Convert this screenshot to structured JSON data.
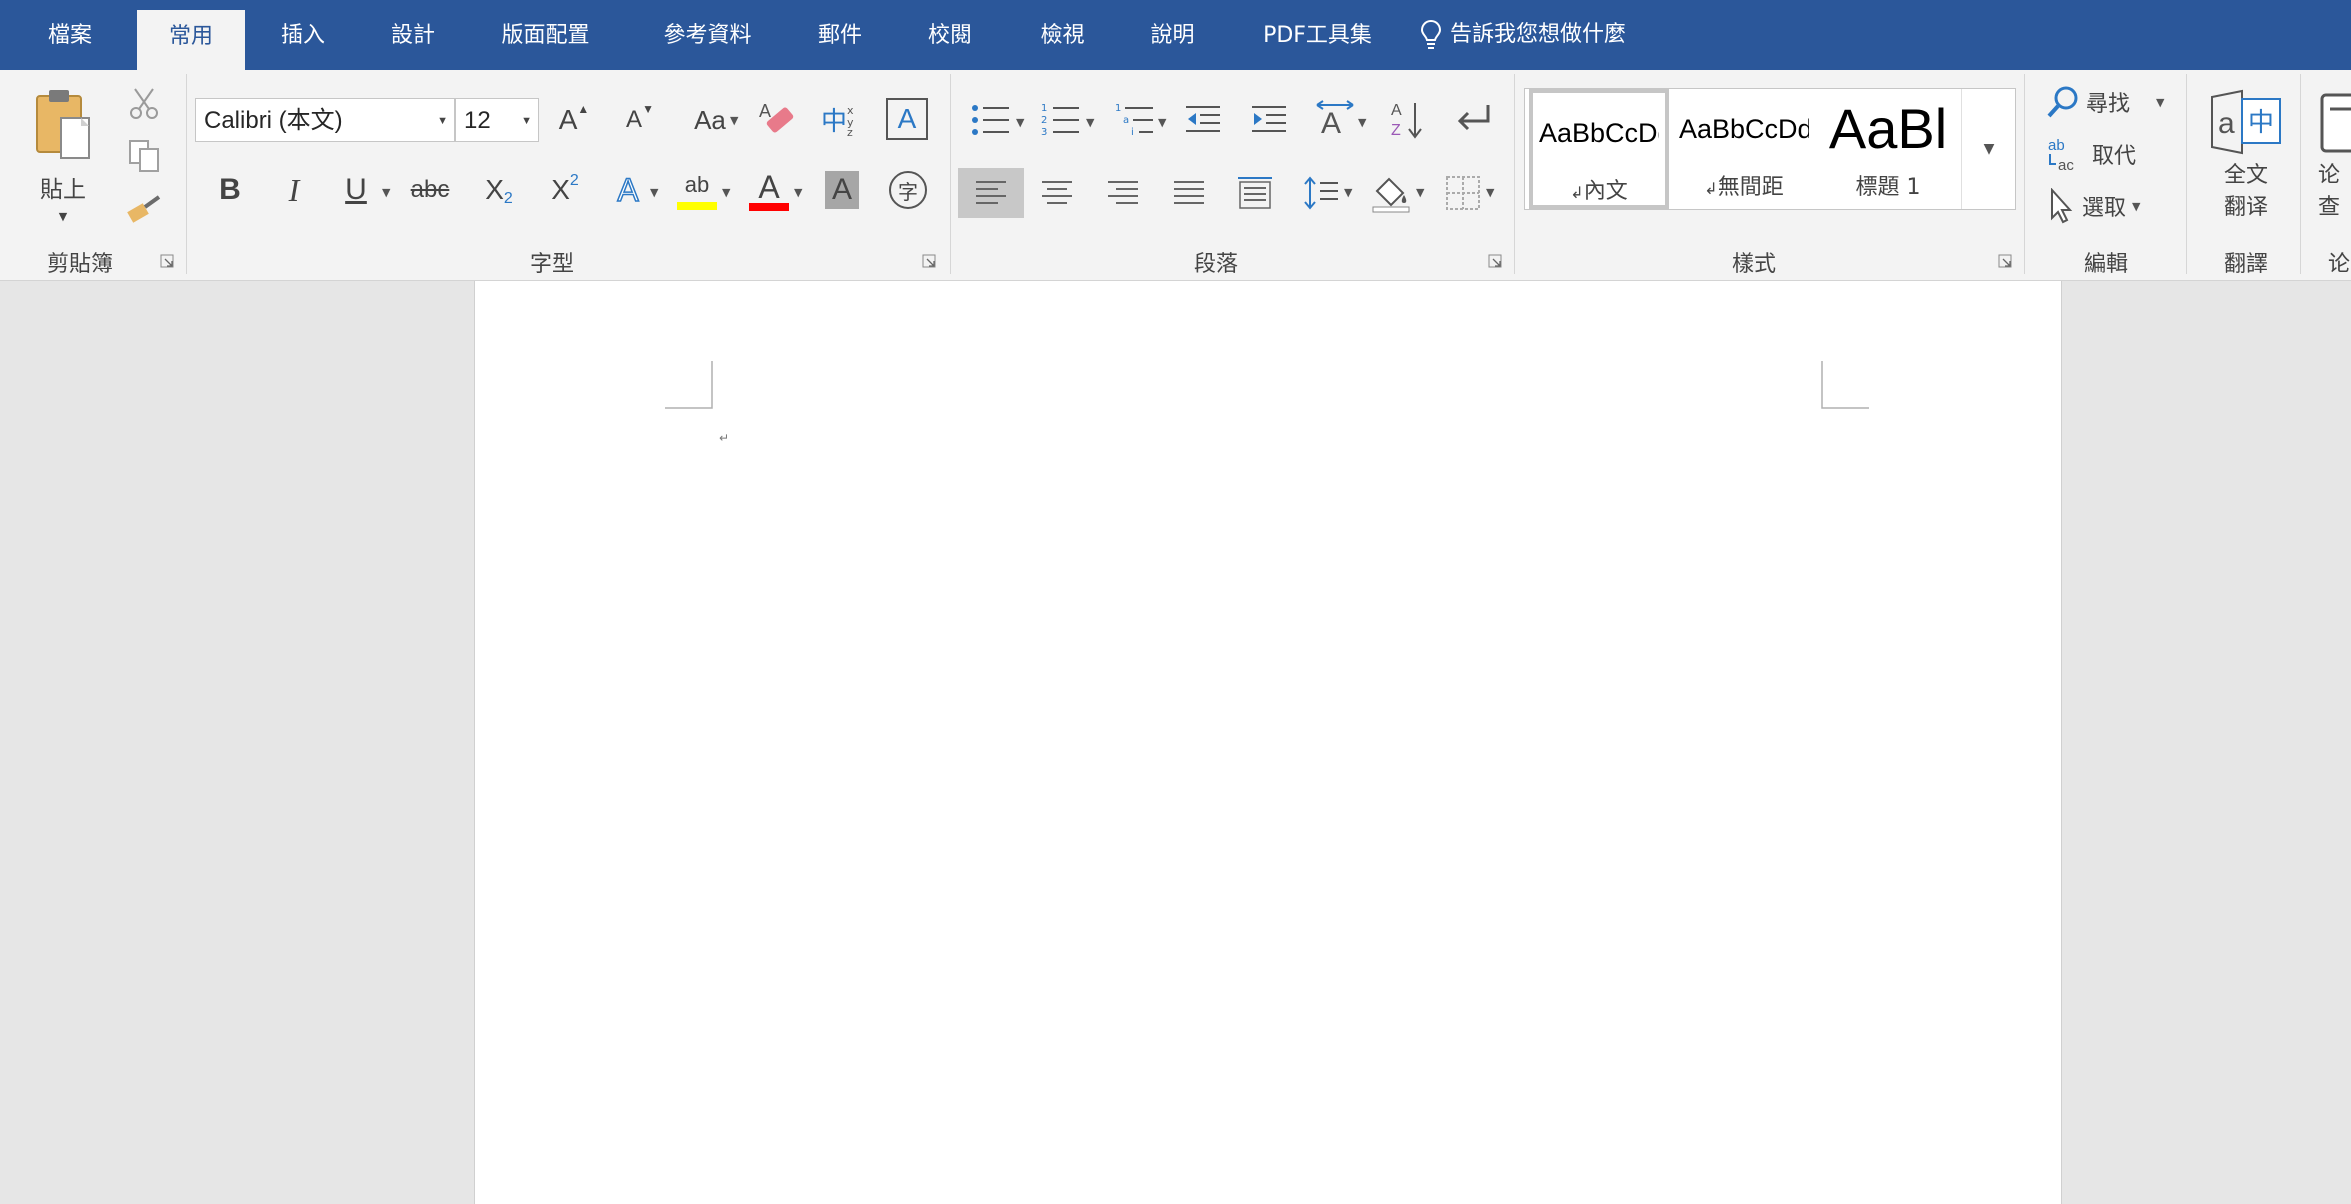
{
  "tabs": [
    "檔案",
    "常用",
    "插入",
    "設計",
    "版面配置",
    "參考資料",
    "郵件",
    "校閱",
    "檢視",
    "說明",
    "PDF工具集"
  ],
  "active_tab": "常用",
  "tell_me": "告訴我您想做什麼",
  "groups": {
    "clipboard": "剪貼簿",
    "font": "字型",
    "paragraph": "段落",
    "styles": "樣式",
    "editing": "編輯",
    "translate": "翻譯",
    "partial_next": "论"
  },
  "clipboard": {
    "paste_label": "貼上"
  },
  "font": {
    "name": "Calibri (本文)",
    "size": "12",
    "change_case": "Aa",
    "phonetic": "中",
    "bold": "B",
    "italic": "I",
    "underline": "U",
    "strike": "abc",
    "subscript": "X",
    "superscript": "X",
    "text_effects": "A",
    "highlight": "ab",
    "font_color": "A",
    "char_shading": "A",
    "enclose": "字",
    "grow": "A",
    "shrink": "A",
    "border_char": "A"
  },
  "styles": [
    {
      "sample": "AaBbCcDd",
      "name": "內文"
    },
    {
      "sample": "AaBbCcDd",
      "name": "無間距"
    },
    {
      "sample": "AaBl",
      "name": "標題 1"
    }
  ],
  "editing": {
    "find": "尋找",
    "replace": "取代",
    "select": "選取"
  },
  "translate": {
    "line1": "全文",
    "line2": "翻译"
  },
  "partial_next": {
    "line1": "论",
    "line2": "查"
  },
  "colors": {
    "tabbar": "#2b579a",
    "highlight": "#ffff00",
    "font_color": "#ff0000",
    "accent_blue": "#2b579a"
  }
}
